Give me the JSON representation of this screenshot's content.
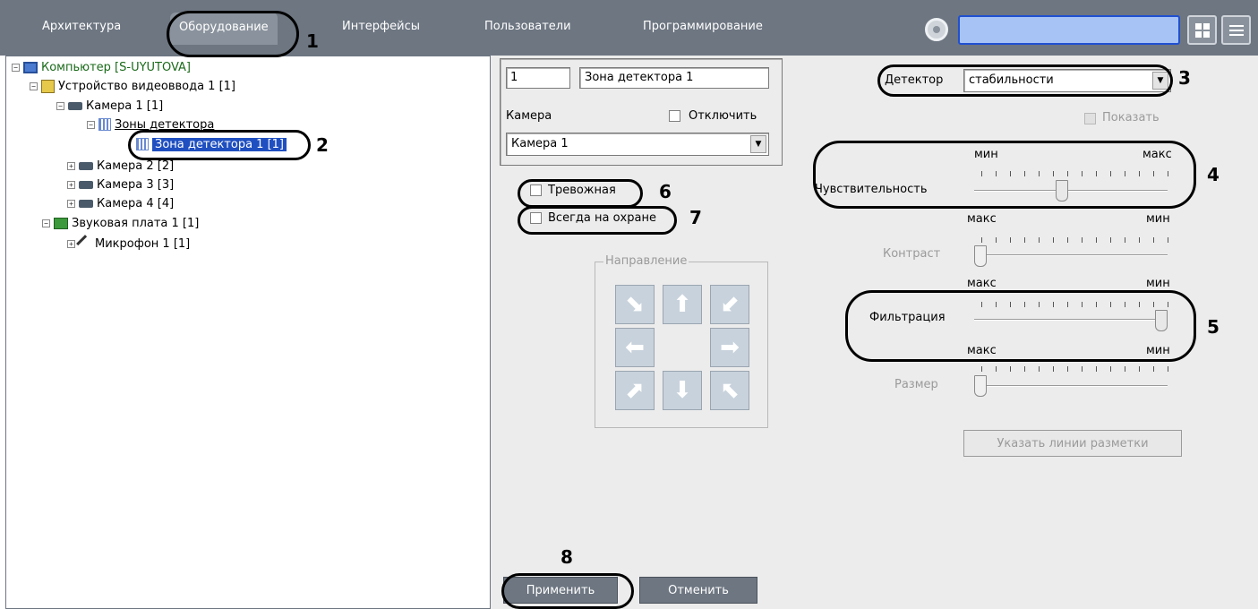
{
  "menu": {
    "tabs": [
      "Архитектура",
      "Оборудование",
      "Интерфейсы",
      "Пользователи",
      "Программирование"
    ],
    "active": "Оборудование"
  },
  "tree": {
    "computer": "Компьютер [S-UYUTOVA]",
    "video_device": "Устройство видеоввода 1 [1]",
    "camera1": "Камера 1 [1]",
    "zones": "Зоны детектора",
    "zone1": "Зона детектора 1 [1]",
    "camera2": "Камера 2 [2]",
    "camera3": "Камера 3 [3]",
    "camera4": "Камера 4 [4]",
    "sound_card": "Звуковая плата 1 [1]",
    "microphone": "Микрофон 1 [1]"
  },
  "zone": {
    "id": "1",
    "name": "Зона детектора 1",
    "camera_label": "Камера",
    "disable_label": "Отключить",
    "camera_value": "Камера 1"
  },
  "detector": {
    "label": "Детектор",
    "value": "стабильности",
    "show_label": "Показать"
  },
  "options": {
    "alarm_label": "Тревожная",
    "always_armed_label": "Всегда на охране"
  },
  "direction": {
    "label": "Направление"
  },
  "sliders": [
    {
      "label": "Чувствительность",
      "left": "мин",
      "right": "макс",
      "level": 0.45,
      "enabled": true
    },
    {
      "label": "Контраст",
      "left": "макс",
      "right": "мин",
      "level": 0.0,
      "enabled": false
    },
    {
      "label": "Фильтрация",
      "left": "макс",
      "right": "мин",
      "level": 1.0,
      "enabled": true
    },
    {
      "label": "Размер",
      "left": "макс",
      "right": "мин",
      "level": 0.0,
      "enabled": false
    }
  ],
  "markup_button": "Указать линии разметки",
  "buttons": {
    "apply": "Применить",
    "cancel": "Отменить"
  },
  "callouts": [
    "1",
    "2",
    "3",
    "4",
    "5",
    "6",
    "7",
    "8"
  ]
}
